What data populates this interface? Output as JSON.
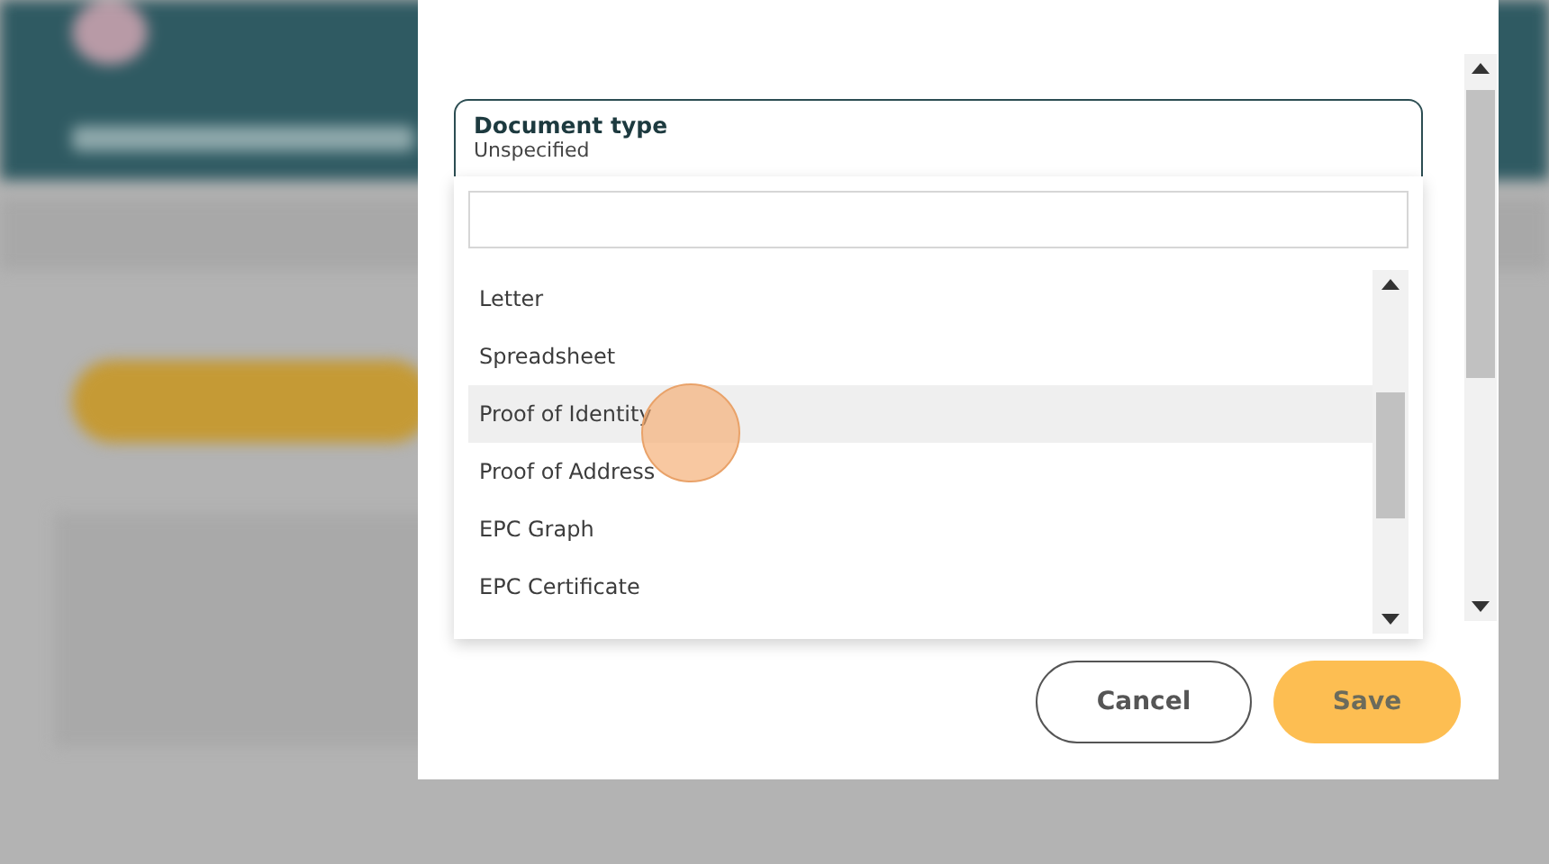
{
  "field": {
    "label": "Document type",
    "value": "Unspecified",
    "expanded": true
  },
  "options": [
    {
      "label": "Letter",
      "highlighted": false
    },
    {
      "label": "Spreadsheet",
      "highlighted": false
    },
    {
      "label": "Proof of Identity",
      "highlighted": true
    },
    {
      "label": "Proof of Address",
      "highlighted": false
    },
    {
      "label": "EPC Graph",
      "highlighted": false
    },
    {
      "label": "EPC Certificate",
      "highlighted": false
    }
  ],
  "buttons": [
    {
      "label": "Cancel",
      "kind": "outline"
    },
    {
      "label": "Save",
      "kind": "primary"
    }
  ]
}
